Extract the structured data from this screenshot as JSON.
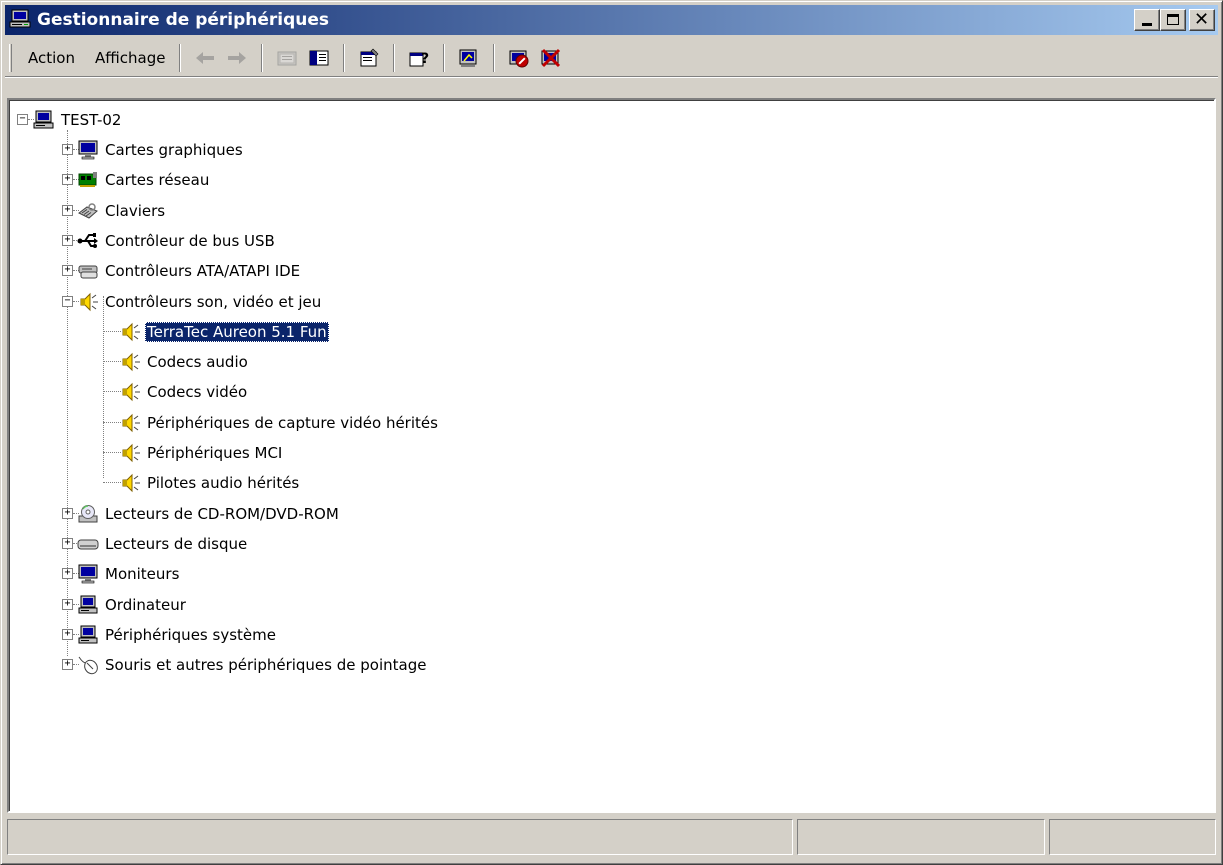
{
  "window": {
    "title": "Gestionnaire de périphériques"
  },
  "menu": {
    "action_label": "Action",
    "view_label": "Affichage"
  },
  "toolbar": {
    "buttons": [
      "back-arrow",
      "forward-arrow",
      "up-folder",
      "show-hide-tree",
      "properties",
      "help",
      "scan-hardware",
      "disable-device",
      "uninstall-device"
    ]
  },
  "tree": {
    "root": "TEST-02",
    "categories": [
      {
        "label": "Cartes graphiques",
        "icon": "display-adapter-icon"
      },
      {
        "label": "Cartes réseau",
        "icon": "network-card-icon"
      },
      {
        "label": "Claviers",
        "icon": "keyboard-icon"
      },
      {
        "label": "Contrôleur de bus USB",
        "icon": "usb-icon"
      },
      {
        "label": "Contrôleurs ATA/ATAPI IDE",
        "icon": "ide-controller-icon"
      },
      {
        "label": "Contrôleurs son, vidéo et jeu",
        "icon": "speaker-icon",
        "expanded": true
      },
      {
        "label": "Lecteurs de CD-ROM/DVD-ROM",
        "icon": "cdrom-icon"
      },
      {
        "label": "Lecteurs de disque",
        "icon": "disk-drive-icon"
      },
      {
        "label": "Moniteurs",
        "icon": "monitor-icon"
      },
      {
        "label": "Ordinateur",
        "icon": "computer-icon"
      },
      {
        "label": "Périphériques système",
        "icon": "system-device-icon"
      },
      {
        "label": "Souris et autres périphériques de pointage",
        "icon": "mouse-icon"
      }
    ],
    "sound_children": [
      {
        "label": "TerraTec Aureon 5.1 Fun",
        "selected": true
      },
      {
        "label": "Codecs audio"
      },
      {
        "label": "Codecs vidéo"
      },
      {
        "label": "Périphériques de capture vidéo hérités"
      },
      {
        "label": "Périphériques MCI"
      },
      {
        "label": "Pilotes audio hérités"
      }
    ]
  },
  "statusbar": {
    "cells": [
      "",
      "",
      ""
    ]
  },
  "colors": {
    "title_active": "#0a246a",
    "title_gradient_end": "#a6caf0",
    "face": "#d4d0c8",
    "selection": "#0a246a"
  }
}
